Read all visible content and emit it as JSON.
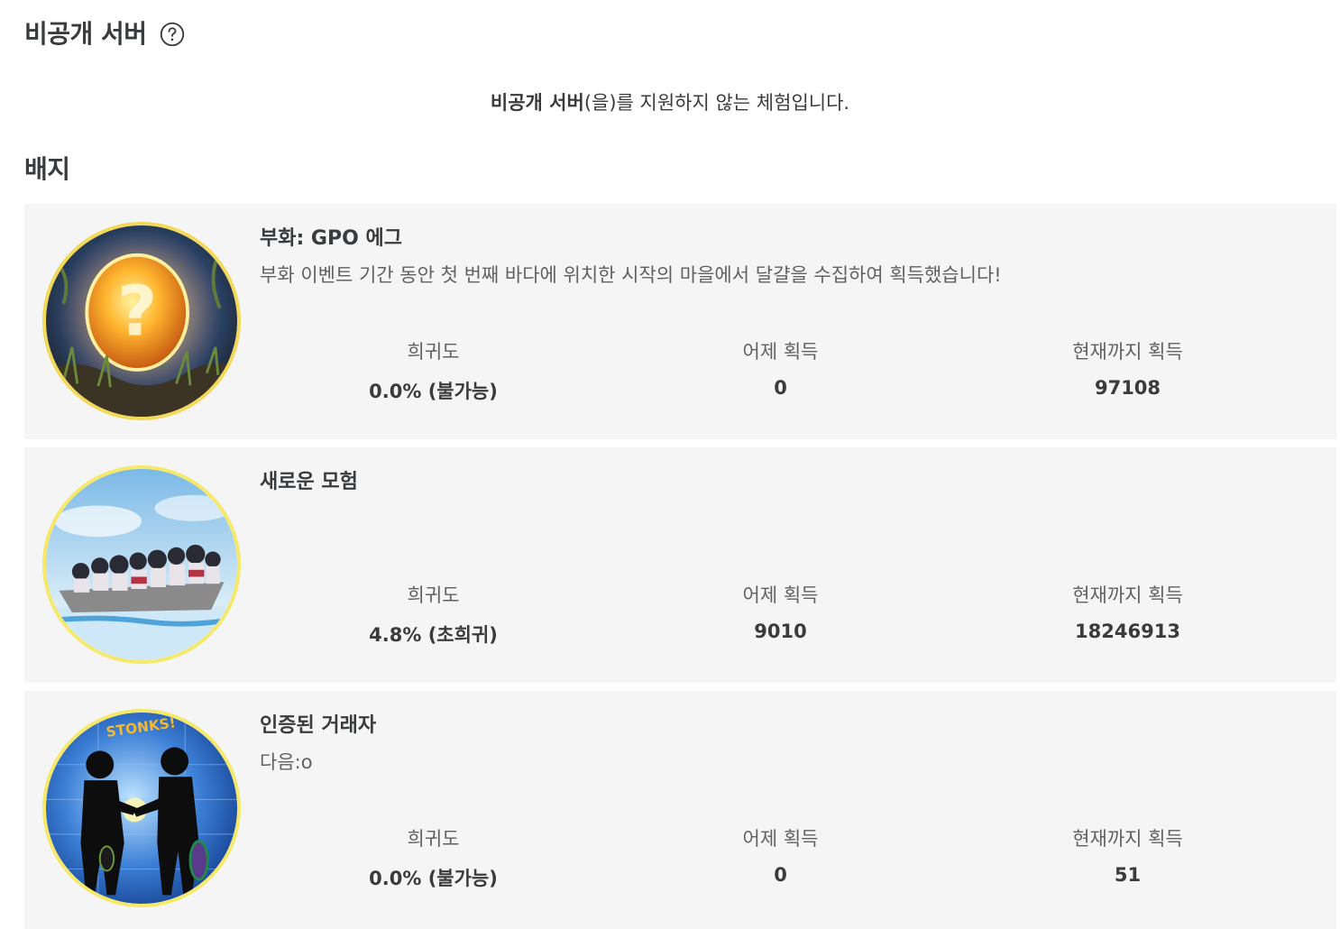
{
  "private_servers": {
    "title": "비공개 서버",
    "help_icon": "question-circle-icon",
    "notice_bold": "비공개 서버",
    "notice_rest": "(을)를 지원하지 않는 체험입니다."
  },
  "badges": {
    "title": "배지",
    "stat_labels": {
      "rarity": "희귀도",
      "won_yesterday": "어제 획득",
      "won_ever": "현재까지 획득"
    },
    "items": [
      {
        "name": "부화: GPO 에그",
        "description": "부화 이벤트 기간 동안 첫 번째 바다에 위치한 시작의 마을에서 달걀을 수집하여 획득했습니다!",
        "rarity": "0.0% (불가능)",
        "won_yesterday": "0",
        "won_ever": "97108",
        "image": "glowing-question-egg-icon"
      },
      {
        "name": "새로운 모험",
        "description": "",
        "rarity": "4.8% (초희귀)",
        "won_yesterday": "9010",
        "won_ever": "18246913",
        "image": "crew-on-boat-icon"
      },
      {
        "name": "인증된 거래자",
        "description": "다음:o",
        "rarity": "0.0% (불가능)",
        "won_yesterday": "0",
        "won_ever": "51",
        "image": "stonks-handshake-icon",
        "image_text": "STONKS!"
      }
    ]
  }
}
